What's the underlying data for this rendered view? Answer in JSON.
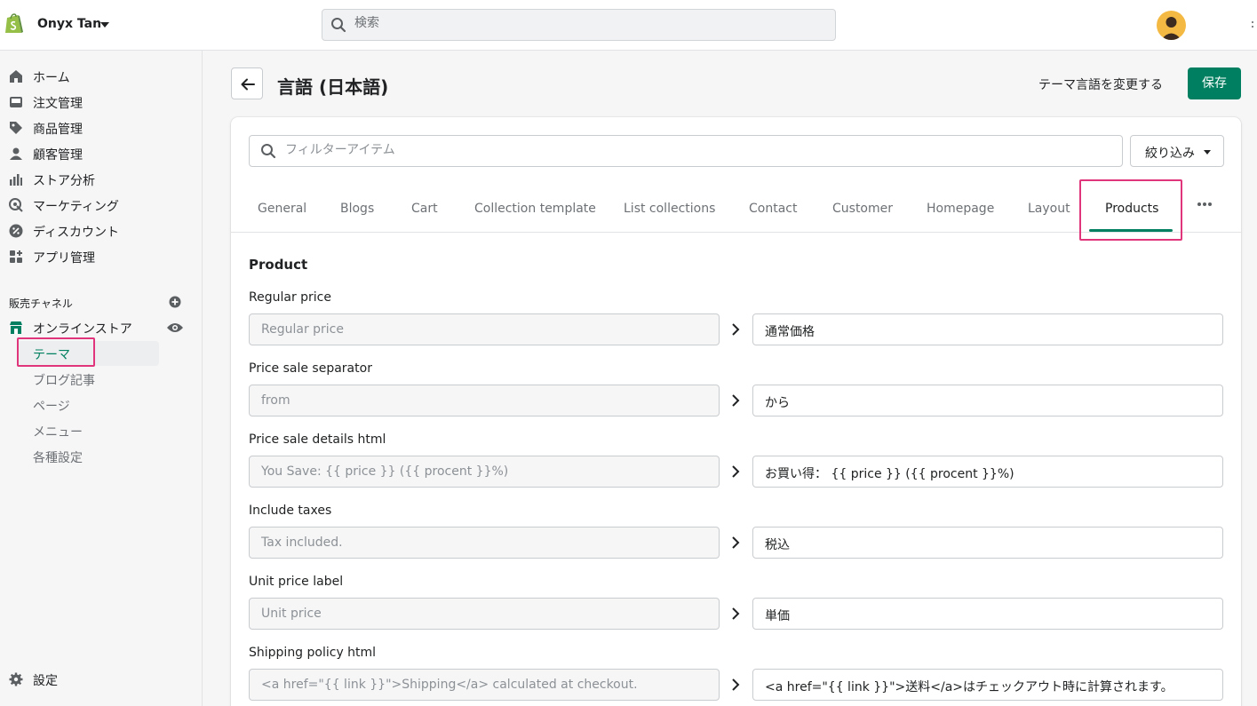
{
  "topbar": {
    "store_name": "Onyx Tan",
    "search_placeholder": "検索"
  },
  "sidebar": {
    "items": [
      {
        "label": "ホーム",
        "icon": "home-icon"
      },
      {
        "label": "注文管理",
        "icon": "inbox-icon"
      },
      {
        "label": "商品管理",
        "icon": "tag-icon"
      },
      {
        "label": "顧客管理",
        "icon": "person-icon"
      },
      {
        "label": "ストア分析",
        "icon": "bar-chart-icon"
      },
      {
        "label": "マーケティング",
        "icon": "target-icon"
      },
      {
        "label": "ディスカウント",
        "icon": "discount-icon"
      },
      {
        "label": "アプリ管理",
        "icon": "apps-icon"
      }
    ],
    "sales_channels_label": "販売チャネル",
    "online_store_label": "オンラインストア",
    "sub_items": [
      {
        "label": "テーマ",
        "active": true
      },
      {
        "label": "ブログ記事",
        "active": false
      },
      {
        "label": "ページ",
        "active": false
      },
      {
        "label": "メニュー",
        "active": false
      },
      {
        "label": "各種設定",
        "active": false
      }
    ],
    "settings_label": "設定"
  },
  "header": {
    "title": "言語 (日本語)",
    "change_language": "テーマ言語を変更する",
    "save": "保存"
  },
  "filter": {
    "placeholder": "フィルターアイテム",
    "narrow_label": "絞り込み"
  },
  "tabs": [
    {
      "label": "General"
    },
    {
      "label": "Blogs"
    },
    {
      "label": "Cart"
    },
    {
      "label": "Collection template"
    },
    {
      "label": "List collections"
    },
    {
      "label": "Contact"
    },
    {
      "label": "Customer"
    },
    {
      "label": "Homepage"
    },
    {
      "label": "Layout"
    },
    {
      "label": "Products",
      "active": true
    }
  ],
  "section": {
    "title": "Product",
    "fields": [
      {
        "label": "Regular price",
        "source": "Regular price",
        "translation": "通常価格"
      },
      {
        "label": "Price sale separator",
        "source": " from",
        "translation": "から"
      },
      {
        "label": "Price sale details html",
        "source": "You Save: {{ price }} ({{ procent }}%)",
        "translation": "お買い得： {{ price }} ({{ procent }}%)"
      },
      {
        "label": "Include taxes",
        "source": "Tax included.",
        "translation": "税込"
      },
      {
        "label": "Unit price label",
        "source": "Unit price",
        "translation": "単価"
      },
      {
        "label": "Shipping policy html",
        "source": "<a href=\"{{ link }}\">Shipping</a> calculated at checkout.",
        "translation": "<a href=\"{{ link }}\">送料</a>はチェックアウト時に計算されます。"
      }
    ]
  },
  "colors": {
    "accent": "#008060",
    "highlight": "#e0357a"
  }
}
